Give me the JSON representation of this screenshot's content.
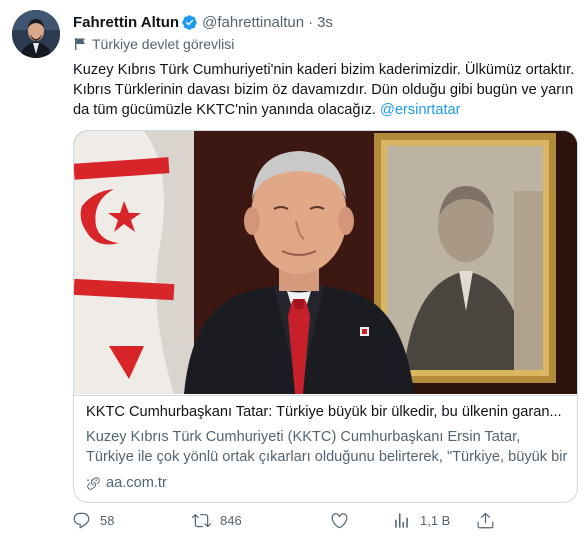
{
  "author": {
    "name": "Fahrettin Altun",
    "handle": "@fahrettinaltun",
    "separator": "·",
    "time": "3s",
    "label": "Türkiye devlet görevlisi"
  },
  "tweet": {
    "text": "Kuzey Kıbrıs Türk Cumhuriyeti'nin kaderi bizim kaderimizdir. Ülkümüz ortaktır. Kıbrıs Türklerinin davası bizim öz davamızdır. Dün olduğu gibi bugün ve yarın da tüm gücümüzle KKTC'nin yanında olacağız.",
    "mention": "@ersinrtatar"
  },
  "card": {
    "title": "KKTC Cumhurbaşkanı Tatar: Türkiye büyük bir ülkedir, bu ülkenin garan...",
    "description": "Kuzey Kıbrıs Türk Cumhuriyeti (KKTC) Cumhurbaşkanı Ersin Tatar, Türkiye ile çok yönlü ortak çıkarları olduğunu belirterek, \"Türkiye, büyük bir ...",
    "domain": "aa.com.tr"
  },
  "actions": {
    "replies": "58",
    "retweets": "846",
    "likes": "",
    "views": "1,1 B",
    "share": ""
  },
  "colors": {
    "accent": "#1d9bf0",
    "text": "#0f1419",
    "secondary": "#536471",
    "border": "#cfd9de"
  },
  "icons": [
    "verified-badge-icon",
    "government-flag-icon",
    "link-icon",
    "reply-icon",
    "retweet-icon",
    "like-icon",
    "views-icon",
    "share-icon"
  ]
}
